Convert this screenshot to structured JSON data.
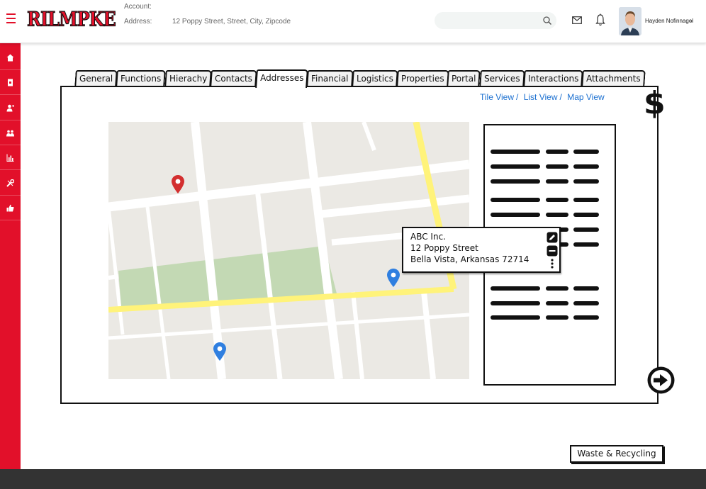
{
  "header": {
    "logo_text": "RILMPKE",
    "account_label": "Account:",
    "address_label": "Address:",
    "address_value": "12 Poppy Street, Street, City, Zipcode",
    "search_placeholder": "",
    "user_name": "Hayden Nofinnagel",
    "user_caret": "⌄"
  },
  "sidebar": {
    "items": [
      {
        "name": "home-icon"
      },
      {
        "name": "document-icon"
      },
      {
        "name": "user-add-icon"
      },
      {
        "name": "group-icon"
      },
      {
        "name": "bar-chart-icon"
      },
      {
        "name": "tools-icon"
      },
      {
        "name": "thumbs-up-icon"
      }
    ]
  },
  "tabs": [
    {
      "label": "General",
      "active": false
    },
    {
      "label": "Functions",
      "active": false
    },
    {
      "label": "Hierachy",
      "active": false
    },
    {
      "label": "Contacts",
      "active": false
    },
    {
      "label": "Addresses",
      "active": true
    },
    {
      "label": "Financial",
      "active": false
    },
    {
      "label": "Logistics",
      "active": false
    },
    {
      "label": "Properties",
      "active": false
    },
    {
      "label": "Portal",
      "active": false
    },
    {
      "label": "Services",
      "active": false
    },
    {
      "label": "Interactions",
      "active": false
    },
    {
      "label": "Attachments",
      "active": false
    }
  ],
  "view_links": {
    "tile": "Tile View",
    "list": "List View",
    "map": "Map View",
    "separator": "/"
  },
  "currency_symbol": "$",
  "map": {
    "pins": [
      {
        "color": "#d32f2f"
      },
      {
        "color": "#2f7fe0"
      },
      {
        "color": "#2f7fe0"
      }
    ]
  },
  "popup": {
    "company": "ABC Inc.",
    "street": "12 Poppy Street",
    "city_line": "Bella Vista, Arkansas 72714"
  },
  "waste_button": "Waste & Recycling",
  "colors": {
    "brand_red": "#e2102a",
    "footer": "#333333",
    "link_blue": "#1a6fd0",
    "map_bg": "#ebe9e4",
    "park": "#c3d9b4",
    "highway": "#fff37a"
  }
}
